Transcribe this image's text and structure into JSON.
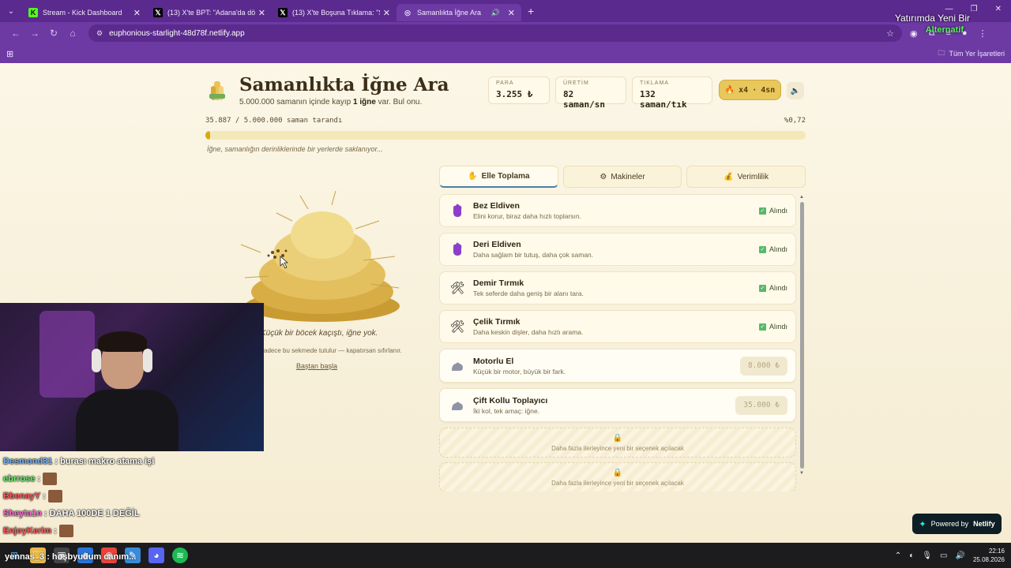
{
  "browser": {
    "tabs": [
      {
        "label": "Stream - Kick Dashboard",
        "icon": "kick-icon",
        "active": false
      },
      {
        "label": "(13) X'te BPT: \"Adana'da dönen",
        "icon": "x-icon",
        "active": false
      },
      {
        "label": "(13) X'te Boşuna Tıklama: \"Sam",
        "icon": "x-icon",
        "active": false
      },
      {
        "label": "Samanlıkta İğne Ara",
        "icon": "globe-icon",
        "active": true
      }
    ],
    "url": "euphonious-starlight-48d78f.netlify.app",
    "bookmarks_folder": "Tüm Yer İşaretleri"
  },
  "stream_overlay": {
    "top_line1": "Yatırımda Yeni Bir",
    "top_line2": "Alternatif"
  },
  "game": {
    "title": "Samanlıkta İğne Ara",
    "subtitle_pre": "5.000.000 samanın içinde kayıp ",
    "subtitle_bold": "1 iğne",
    "subtitle_post": " var. Bul onu.",
    "stats": {
      "para_label": "PARA",
      "para_value": "3.255 ₺",
      "uretim_label": "ÜRETİM",
      "uretim_value": "82 saman/sn",
      "tiklama_label": "TIKLAMA",
      "tiklama_value": "132 saman/tık"
    },
    "boost": {
      "multiplier": "x4",
      "sep": "·",
      "duration": "4sn"
    },
    "progress": {
      "text": "35.887 / 5.000.000 saman tarandı",
      "percent_text": "%0,72",
      "fraction": 0.0072
    },
    "hint": "İğne, samanlığın derinliklerinde bir yerlerde saklanıyor...",
    "haystack_caption": "Küçük bir böcek kaçıştı, iğne yok.",
    "haystack_note": "sadece bu sekmede tutulur — kapatırsan sıfırlanır.",
    "reset": "Baştan başla"
  },
  "shop": {
    "tabs": [
      {
        "label": "Elle Toplama",
        "icon": "hand-icon",
        "active": true
      },
      {
        "label": "Makineler",
        "icon": "gear-icon",
        "active": false
      },
      {
        "label": "Verimlilik",
        "icon": "money-bag-icon",
        "active": false
      }
    ],
    "owned_label": "Alındı",
    "items": [
      {
        "name": "Bez Eldiven",
        "desc": "Elini korur, biraz daha hızlı toplarsın.",
        "icon": "glove-icon",
        "owned": true
      },
      {
        "name": "Deri Eldiven",
        "desc": "Daha sağlam bir tutuş, daha çok saman.",
        "icon": "glove-icon",
        "owned": true
      },
      {
        "name": "Demir Tırmık",
        "desc": "Tek seferde daha geniş bir alanı tara.",
        "icon": "rake-icon",
        "owned": true
      },
      {
        "name": "Çelik Tırmık",
        "desc": "Daha keskin dişler, daha hızlı arama.",
        "icon": "rake-icon",
        "owned": true
      },
      {
        "name": "Motorlu El",
        "desc": "Küçük bir motor, büyük bir fark.",
        "icon": "arm-icon",
        "owned": false,
        "price": "8.000 ₺"
      },
      {
        "name": "Çift Kollu Toplayıcı",
        "desc": "İki kol, tek amaç: iğne.",
        "icon": "arm-icon",
        "owned": false,
        "price": "35.000 ₺"
      }
    ],
    "locked_text": "Daha fazla ilerleyince yeni bir seçenek açılacak"
  },
  "netlify_badge": {
    "pre": "Powered by",
    "brand": "Netlify"
  },
  "chat": [
    {
      "user": "Desmond31",
      "color": "#6fb4ff",
      "msg": ": burası makro atama işi"
    },
    {
      "user": "ebrrose",
      "color": "#6cf06c",
      "msg": ":"
    },
    {
      "user": "BbenayY",
      "color": "#ff5a5a",
      "msg": ":"
    },
    {
      "user": "Sheyta1n",
      "color": "#ff6ad5",
      "msg": ": DAHA 100DE 1 DEĞİL"
    },
    {
      "user": "EnjoyKerim",
      "color": "#ff5a5a",
      "msg": ":"
    }
  ],
  "taskbar_chat": "yennas_3 : hoşbyudum canım...",
  "clock": {
    "time": "22:16",
    "date": "25.08.2026"
  }
}
